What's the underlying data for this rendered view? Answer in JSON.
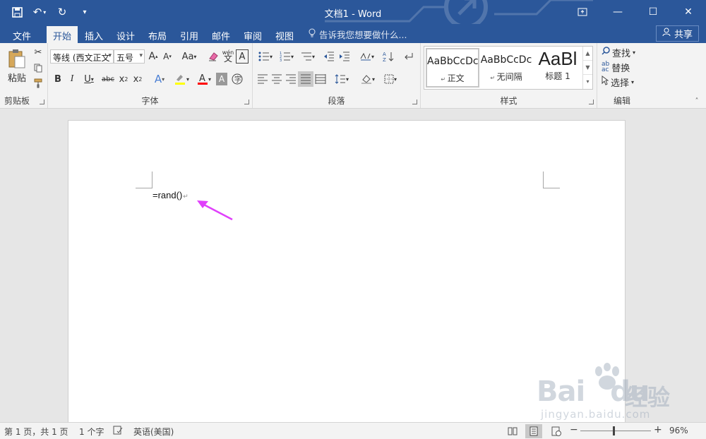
{
  "window": {
    "title": "文档1 - Word",
    "controls": [
      "restore-ribbon",
      "minimize",
      "maximize",
      "close"
    ]
  },
  "quick_access": [
    "save-icon",
    "undo-icon",
    "redo-icon",
    "customize-icon"
  ],
  "tabs": [
    {
      "label": "文件"
    },
    {
      "label": "开始"
    },
    {
      "label": "插入"
    },
    {
      "label": "设计"
    },
    {
      "label": "布局"
    },
    {
      "label": "引用"
    },
    {
      "label": "邮件"
    },
    {
      "label": "审阅"
    },
    {
      "label": "视图"
    }
  ],
  "active_tab": "开始",
  "tell_me": "告诉我您想要做什么...",
  "share_label": "共享",
  "ribbon": {
    "clipboard": {
      "paste_label": "粘贴",
      "group_label": "剪贴板"
    },
    "font": {
      "font_name": "等线 (西文正文",
      "font_size": "五号",
      "group_label": "字体",
      "change_case": "Aa",
      "pinyin": "wén",
      "pinyin_char": "文"
    },
    "paragraph": {
      "group_label": "段落"
    },
    "styles": {
      "group_label": "样式",
      "items": [
        {
          "sample": "AaBbCcDc",
          "name": "正文"
        },
        {
          "sample": "AaBbCcDc",
          "name": "无间隔"
        },
        {
          "sample": "AaBl",
          "name": "标题 1"
        }
      ]
    },
    "editing": {
      "find": "查找",
      "replace": "替换",
      "select": "选择",
      "group_label": "编辑"
    }
  },
  "document": {
    "text": "=rand()",
    "annotation_color": "#e040fb"
  },
  "status": {
    "page": "第 1 页，共 1 页",
    "words": "1 个字",
    "language": "英语(美国)",
    "zoom": "96%",
    "zoom_minus": "−",
    "zoom_plus": "+"
  },
  "watermark": {
    "brand": "Bai",
    "brand2": "du",
    "cn": "经验",
    "url": "jingyan.baidu.com"
  },
  "colors": {
    "accent": "#2b579a",
    "highlight": "#ffff00",
    "font_color": "#ff0000"
  }
}
